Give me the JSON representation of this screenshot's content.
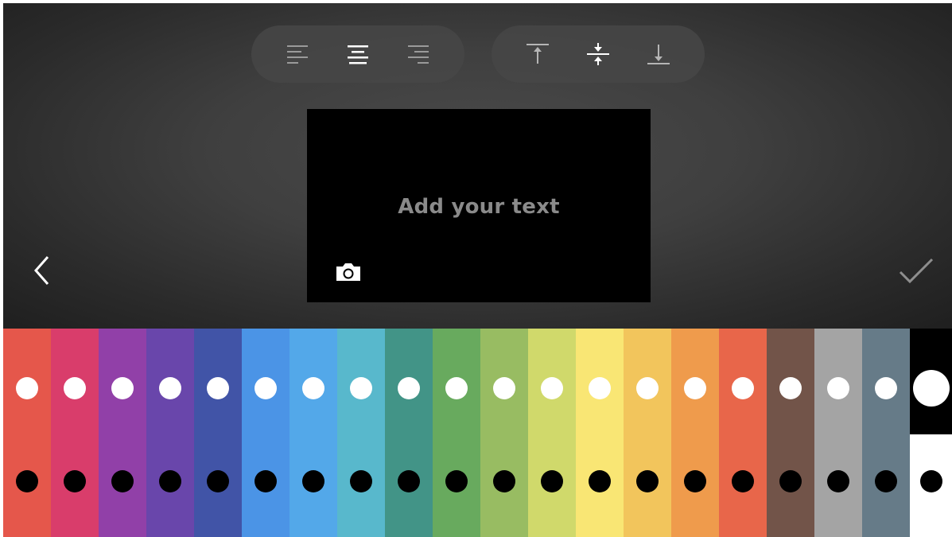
{
  "editor": {
    "placeholder_text": "Add your text",
    "toolbar": {
      "horizontal_alignment": [
        "align-left",
        "align-center",
        "align-right"
      ],
      "vertical_alignment": [
        "align-top",
        "align-middle",
        "align-bottom"
      ],
      "selected_horizontal": "align-center"
    }
  },
  "colors": {
    "editor_background": "#3f3f3f",
    "preview_background": "#000000",
    "placeholder_color": "#8a8a8a",
    "swatches": [
      "#e5574b",
      "#d93d6b",
      "#9140a8",
      "#6946ab",
      "#4154a7",
      "#4b94e6",
      "#53a8e9",
      "#58b8cc",
      "#429487",
      "#68aa5e",
      "#98bc62",
      "#d0d96b",
      "#f9e674",
      "#f2c55c",
      "#ef9b4c",
      "#e8664a",
      "#725449",
      "#a4a4a4",
      "#667b88"
    ],
    "mono_top": "#000000",
    "mono_bottom": "#ffffff"
  }
}
